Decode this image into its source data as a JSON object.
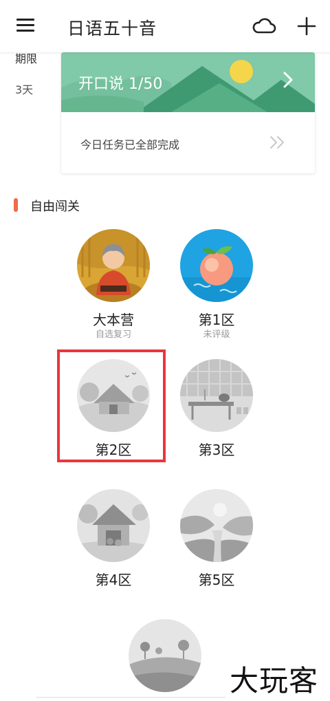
{
  "header": {
    "title": "日语五十音"
  },
  "left_panel": {
    "label": "期限",
    "value": "3天"
  },
  "card": {
    "banner_text": "开口说 1/50",
    "task_text": "今日任务已全部完成"
  },
  "section": {
    "title": "自由闯关"
  },
  "levels": [
    {
      "name": "大本营",
      "sub": "自选复习"
    },
    {
      "name": "第1区",
      "sub": "未评级"
    },
    {
      "name": "第2区",
      "sub": ""
    },
    {
      "name": "第3区",
      "sub": ""
    },
    {
      "name": "第4区",
      "sub": ""
    },
    {
      "name": "第5区",
      "sub": ""
    }
  ],
  "watermark": "大玩客",
  "colors": {
    "accent": "#f06a4a",
    "banner": "#7fcaaa",
    "highlight": "#e9363c",
    "locked_gray": "#bdbdbd"
  }
}
